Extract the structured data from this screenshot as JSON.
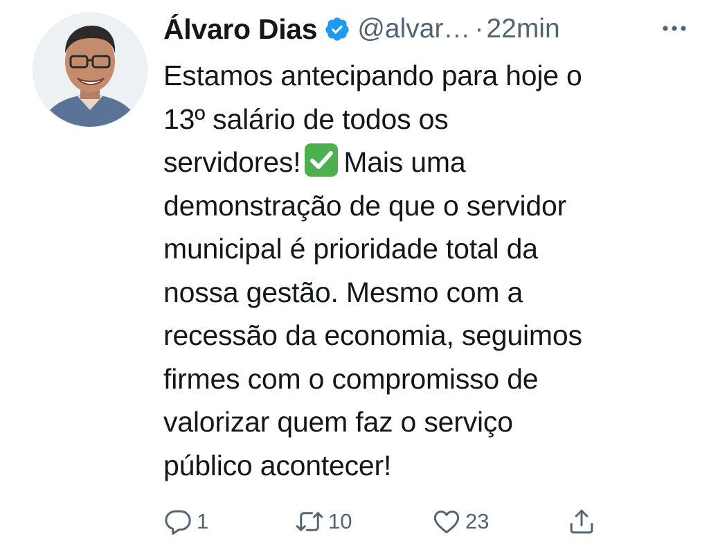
{
  "tweet": {
    "author": {
      "name": "Álvaro Dias",
      "handle": "@alvar…",
      "verified_icon": "verified-badge-icon"
    },
    "separator": "·",
    "time": "22min",
    "more_icon": "more-options-icon",
    "text_lines": [
      {
        "before": "Estamos antecipando para hoje o",
        "after": ""
      },
      {
        "before": "13º salário de todos os",
        "after": ""
      },
      {
        "before": "servidores!",
        "after": "Mais uma",
        "emoji": "check-mark-emoji-icon"
      },
      {
        "before": "demonstração de que o servidor",
        "after": ""
      },
      {
        "before": "municipal é prioridade total da",
        "after": ""
      },
      {
        "before": "nossa gestão. Mesmo com a",
        "after": ""
      },
      {
        "before": "recessão da economia, seguimos",
        "after": ""
      },
      {
        "before": "firmes com o compromisso de",
        "after": ""
      },
      {
        "before": "valorizar quem faz o serviço",
        "after": ""
      },
      {
        "before": "público acontecer!",
        "after": ""
      }
    ],
    "actions": {
      "reply": {
        "icon": "reply-icon",
        "count": "1"
      },
      "retweet": {
        "icon": "retweet-icon",
        "count": "10"
      },
      "like": {
        "icon": "heart-icon",
        "count": "23"
      },
      "share": {
        "icon": "share-icon",
        "count": ""
      }
    },
    "colors": {
      "text": "#14171a",
      "secondary": "#536471",
      "verified": "#1d9bf0",
      "check_green": "#4caf50"
    }
  }
}
